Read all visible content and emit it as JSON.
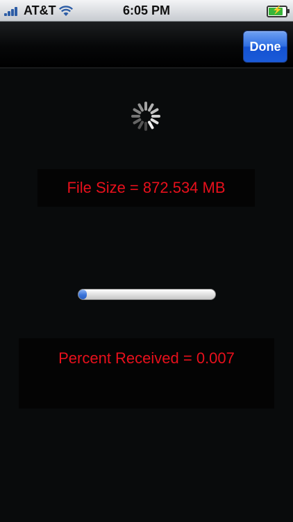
{
  "status_bar": {
    "carrier": "AT&T",
    "time": "6:05 PM",
    "signal_icon": "signal-bars-icon",
    "wifi_icon": "wifi-icon",
    "battery_icon": "battery-charging-icon",
    "battery_level": 0.9
  },
  "nav": {
    "done_label": "Done",
    "accent_color": "#2f6fe3"
  },
  "content": {
    "spinner_icon": "activity-spinner-icon",
    "file_size_text": "File Size = 872.534 MB",
    "progress_fraction": 0.05,
    "percent_text": "Percent Received =  0.007",
    "text_color": "#e8101c"
  }
}
